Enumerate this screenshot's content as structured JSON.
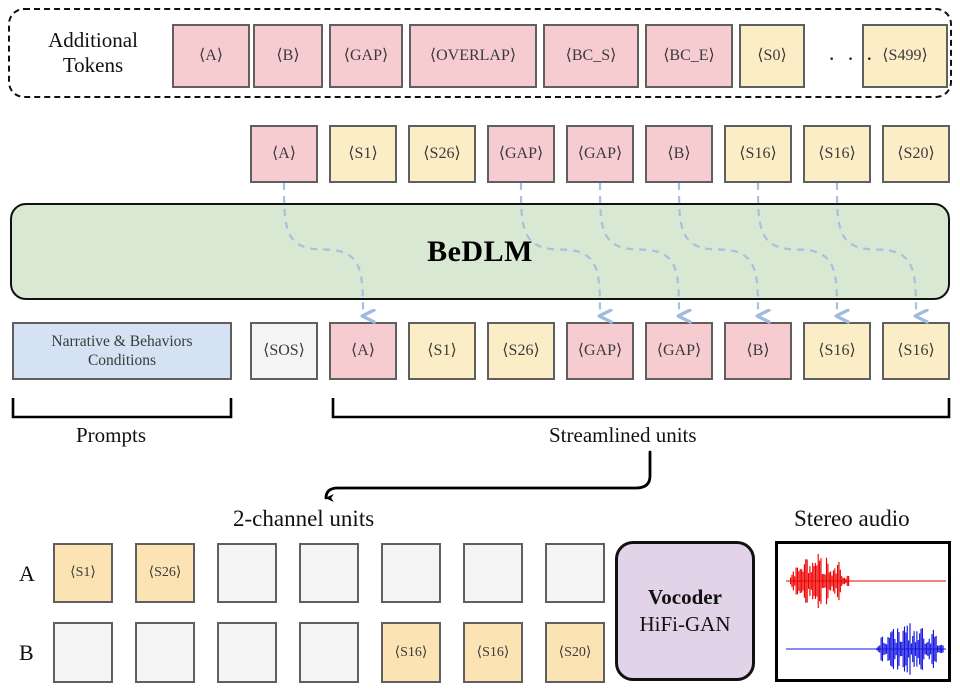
{
  "additional_tokens": {
    "label_line1": "Additional",
    "label_line2": "Tokens",
    "ellipsis": "· · ·",
    "tokens": [
      {
        "text": "⟨A⟩",
        "kind": "pink"
      },
      {
        "text": "⟨B⟩",
        "kind": "pink"
      },
      {
        "text": "⟨GAP⟩",
        "kind": "pink"
      },
      {
        "text": "⟨OVERLAP⟩",
        "kind": "pink"
      },
      {
        "text": "⟨BC_S⟩",
        "kind": "pink"
      },
      {
        "text": "⟨BC_E⟩",
        "kind": "pink"
      },
      {
        "text": "⟨S0⟩",
        "kind": "cream"
      },
      {
        "text": "⟨S499⟩",
        "kind": "cream"
      }
    ]
  },
  "output_row": {
    "tokens": [
      {
        "text": "⟨A⟩",
        "kind": "pink"
      },
      {
        "text": "⟨S1⟩",
        "kind": "cream"
      },
      {
        "text": "⟨S26⟩",
        "kind": "cream"
      },
      {
        "text": "⟨GAP⟩",
        "kind": "pink"
      },
      {
        "text": "⟨GAP⟩",
        "kind": "pink"
      },
      {
        "text": "⟨B⟩",
        "kind": "pink"
      },
      {
        "text": "⟨S16⟩",
        "kind": "cream"
      },
      {
        "text": "⟨S16⟩",
        "kind": "cream"
      },
      {
        "text": "⟨S20⟩",
        "kind": "cream"
      }
    ]
  },
  "model": {
    "name": "BeDLM",
    "fill": "#d8e8d2"
  },
  "input_row": {
    "prompt_box": {
      "line1": "Narrative & Behaviors",
      "line2": "Conditions",
      "fill": "#d4e2f4"
    },
    "tokens": [
      {
        "text": "⟨SOS⟩",
        "kind": "gray"
      },
      {
        "text": "⟨A⟩",
        "kind": "pink"
      },
      {
        "text": "⟨S1⟩",
        "kind": "cream"
      },
      {
        "text": "⟨S26⟩",
        "kind": "cream"
      },
      {
        "text": "⟨GAP⟩",
        "kind": "pink"
      },
      {
        "text": "⟨GAP⟩",
        "kind": "pink"
      },
      {
        "text": "⟨B⟩",
        "kind": "pink"
      },
      {
        "text": "⟨S16⟩",
        "kind": "cream"
      },
      {
        "text": "⟨S16⟩",
        "kind": "cream"
      }
    ]
  },
  "braces": {
    "prompts_label": "Prompts",
    "streamlined_label": "Streamlined units"
  },
  "two_channel": {
    "title": "2-channel units",
    "row_a_label": "A",
    "row_b_label": "B",
    "row_a": [
      {
        "text": "⟨S1⟩",
        "kind": "amber"
      },
      {
        "text": "⟨S26⟩",
        "kind": "amber"
      },
      {
        "text": "",
        "kind": "gray"
      },
      {
        "text": "",
        "kind": "gray"
      },
      {
        "text": "",
        "kind": "gray"
      },
      {
        "text": "",
        "kind": "gray"
      },
      {
        "text": "",
        "kind": "gray"
      }
    ],
    "row_b": [
      {
        "text": "",
        "kind": "gray"
      },
      {
        "text": "",
        "kind": "gray"
      },
      {
        "text": "",
        "kind": "gray"
      },
      {
        "text": "",
        "kind": "gray"
      },
      {
        "text": "⟨S16⟩",
        "kind": "amber"
      },
      {
        "text": "⟨S16⟩",
        "kind": "amber"
      },
      {
        "text": "⟨S20⟩",
        "kind": "amber"
      }
    ]
  },
  "vocoder": {
    "line1": "Vocoder",
    "line2": "HiFi-GAN",
    "fill": "#e2d3e9"
  },
  "stereo_audio": {
    "title": "Stereo audio",
    "channel_top_color": "#ee0000",
    "channel_bottom_color": "#1414e0"
  },
  "colors": {
    "pink": "#f6ccd1",
    "cream": "#fbeec7",
    "gray": "#f5f5f5",
    "blue": "#d4e2f4",
    "amber": "#fce3b4",
    "green": "#d8e8d2",
    "purple": "#e2d3e9",
    "arrow": "#a8c0e0",
    "border": "#5f5f5f"
  }
}
